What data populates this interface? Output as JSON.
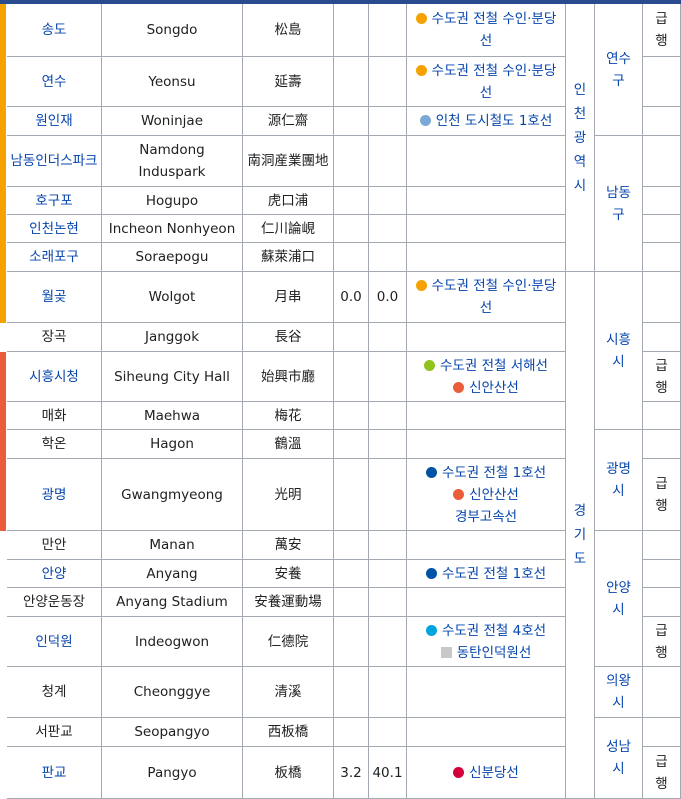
{
  "colors": {
    "suin_bundang": "#F5A200",
    "incheon1": "#7CA8D5",
    "seohae": "#8FC31F",
    "sinansan": "#EB5C3B",
    "line1": "#0052A4",
    "line4": "#00A5DE",
    "dongtan_indeogwon": "#C8C8C8",
    "sinbundang": "#D4003B",
    "link": "#0645ad"
  },
  "stations": [
    {
      "ko": "송도",
      "en": "Songdo",
      "hanja": "松島",
      "link": true,
      "transfers": [
        {
          "lines": [
            {
              "text": "수도권 전철 수인·분당선",
              "color": "suin_bundang",
              "shape": "dot"
            }
          ]
        }
      ],
      "express": "급행"
    },
    {
      "ko": "연수",
      "en": "Yeonsu",
      "hanja": "延壽",
      "link": true,
      "transfers": [
        {
          "lines": [
            {
              "text": "수도권 전철 수인·분당선",
              "color": "suin_bundang",
              "shape": "dot"
            }
          ]
        }
      ]
    },
    {
      "ko": "원인재",
      "en": "Woninjae",
      "hanja": "源仁齋",
      "link": true,
      "transfers": [
        {
          "lines": [
            {
              "text": "인천 도시철도 1호선",
              "color": "incheon1",
              "shape": "dot"
            }
          ]
        }
      ]
    },
    {
      "ko": "남동인더스파크",
      "en": "Namdong Induspark",
      "hanja": "南洞産業團地",
      "link": true
    },
    {
      "ko": "호구포",
      "en": "Hogupo",
      "hanja": "虎口浦",
      "link": true
    },
    {
      "ko": "인천논현",
      "en": "Incheon Nonhyeon",
      "hanja": "仁川論峴",
      "link": true
    },
    {
      "ko": "소래포구",
      "en": "Soraepogu",
      "hanja": "蘇萊浦口",
      "link": true
    },
    {
      "ko": "월곶",
      "en": "Wolgot",
      "hanja": "月串",
      "link": true,
      "dist1": "0.0",
      "dist2": "0.0",
      "transfers": [
        {
          "lines": [
            {
              "text": "수도권 전철 수인·분당선",
              "color": "suin_bundang",
              "shape": "dot"
            }
          ]
        }
      ]
    },
    {
      "ko": "장곡",
      "en": "Janggok",
      "hanja": "長谷",
      "link": false
    },
    {
      "ko": "시흥시청",
      "en": "Siheung City Hall",
      "hanja": "始興市廳",
      "link": true,
      "transfers": [
        {
          "lines": [
            {
              "text": "수도권 전철 서해선",
              "color": "seohae",
              "shape": "dot"
            },
            {
              "text": "신안산선",
              "color": "sinansan",
              "shape": "dot"
            }
          ]
        }
      ],
      "express": "급행"
    },
    {
      "ko": "매화",
      "en": "Maehwa",
      "hanja": "梅花",
      "link": false
    },
    {
      "ko": "학온",
      "en": "Hagon",
      "hanja": "鶴溫",
      "link": false
    },
    {
      "ko": "광명",
      "en": "Gwangmyeong",
      "hanja": "光明",
      "link": true,
      "transfers": [
        {
          "lines": [
            {
              "text": "수도권 전철 1호선",
              "color": "line1",
              "shape": "dot"
            },
            {
              "text": "신안산선",
              "color": "sinansan",
              "shape": "dot"
            },
            {
              "text": "경부고속선",
              "color": "",
              "shape": "none"
            }
          ]
        }
      ],
      "express": "급행"
    },
    {
      "ko": "만안",
      "en": "Manan",
      "hanja": "萬安",
      "link": false
    },
    {
      "ko": "안양",
      "en": "Anyang",
      "hanja": "安養",
      "link": true,
      "transfers": [
        {
          "lines": [
            {
              "text": "수도권 전철 1호선",
              "color": "line1",
              "shape": "dot"
            }
          ]
        }
      ]
    },
    {
      "ko": "안양운동장",
      "en": "Anyang Stadium",
      "hanja": "安養運動場",
      "link": false
    },
    {
      "ko": "인덕원",
      "en": "Indeogwon",
      "hanja": "仁德院",
      "link": true,
      "transfers": [
        {
          "lines": [
            {
              "text": "수도권 전철 4호선",
              "color": "line4",
              "shape": "dot"
            },
            {
              "text": "동탄인덕원선",
              "color": "dongtan_indeogwon",
              "shape": "square"
            }
          ]
        }
      ],
      "express": "급행"
    },
    {
      "ko": "청계",
      "en": "Cheonggye",
      "hanja": "清溪",
      "link": false
    },
    {
      "ko": "서판교",
      "en": "Seopangyo",
      "hanja": "西板橋",
      "link": false
    },
    {
      "ko": "판교",
      "en": "Pangyo",
      "hanja": "板橋",
      "link": true,
      "dist1": "3.2",
      "dist2": "40.1",
      "transfers": [
        {
          "lines": [
            {
              "text": "신분당선",
              "color": "sinbundang",
              "shape": "dot"
            }
          ]
        }
      ],
      "express": "급행"
    }
  ],
  "provinces": [
    {
      "name": "인천광역시"
    },
    {
      "name": "경기도"
    }
  ],
  "cities": [
    {
      "name": "연수구"
    },
    {
      "name": "남동구"
    },
    {
      "name": "시흥시"
    },
    {
      "name": "광명시"
    },
    {
      "name": "안양시"
    },
    {
      "name": "의왕시"
    },
    {
      "name": "성남시"
    }
  ],
  "side_bars": [
    {
      "color": "#F5A200"
    },
    {
      "color": "#EB5C3B"
    }
  ]
}
